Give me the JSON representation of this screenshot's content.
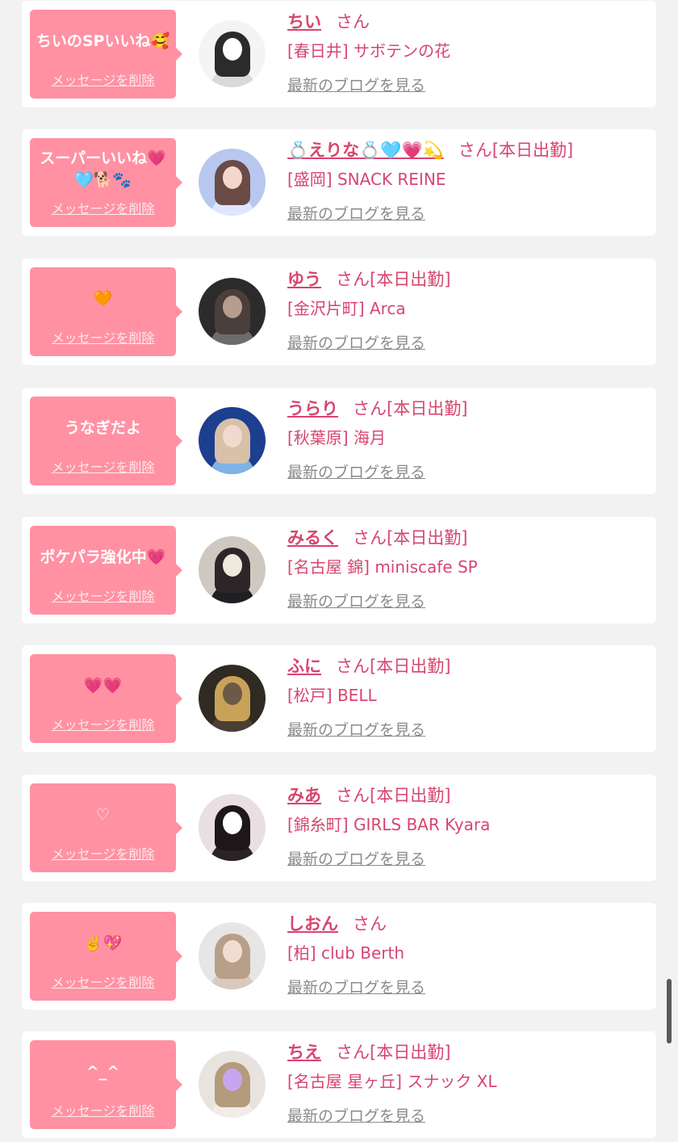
{
  "items": [
    {
      "message": "ちいのSPいいね🥰",
      "delete_label": "メッセージを削除",
      "name": "ちい",
      "honorific": "さん",
      "status": "",
      "shop": "[春日井] サボテンの花",
      "blog_label": "最新のブログを見る",
      "avatar_colors": {
        "bg": "#f4f4f4",
        "hair": "#2b2b2b",
        "face": "#ffffff",
        "body": "#d9d9d9"
      }
    },
    {
      "message": "スーパーいいね💗🩵🐕🐾",
      "delete_label": "メッセージを削除",
      "name": "💍えりな💍🩵💗💫",
      "honorific": "さん",
      "status": "[本日出勤]",
      "shop": "[盛岡] SNACK REINE",
      "blog_label": "最新のブログを見る",
      "avatar_colors": {
        "bg": "#b7c7ee",
        "hair": "#6a4b45",
        "face": "#f3d7cb",
        "body": "#dfe6ff"
      }
    },
    {
      "message": "🧡",
      "delete_label": "メッセージを削除",
      "name": "ゆう",
      "honorific": "さん",
      "status": "[本日出勤]",
      "shop": "[金沢片町] Arca",
      "blog_label": "最新のブログを見る",
      "avatar_colors": {
        "bg": "#2d2a2c",
        "hair": "#4a3f3a",
        "face": "#b79d8c",
        "body": "#6d6b6e"
      }
    },
    {
      "message": "うなぎだよ",
      "delete_label": "メッセージを削除",
      "name": "うらり",
      "honorific": "さん",
      "status": "[本日出勤]",
      "shop": "[秋葉原] 海月",
      "blog_label": "最新のブログを見る",
      "avatar_colors": {
        "bg": "#1d3f8f",
        "hair": "#d7c1a8",
        "face": "#f2d9cf",
        "body": "#7fb3e6"
      }
    },
    {
      "message": "ポケパラ強化中💗",
      "delete_label": "メッセージを削除",
      "name": "みるく",
      "honorific": "さん",
      "status": "[本日出勤]",
      "shop": "[名古屋 錦] miniscafe SP",
      "blog_label": "最新のブログを見る",
      "avatar_colors": {
        "bg": "#cfc8c0",
        "hair": "#2c2628",
        "face": "#efe8dc",
        "body": "#1f1f24"
      }
    },
    {
      "message": "💗💗",
      "delete_label": "メッセージを削除",
      "name": "ふに",
      "honorific": "さん",
      "status": "[本日出勤]",
      "shop": "[松戸] BELL",
      "blog_label": "最新のブログを見る",
      "avatar_colors": {
        "bg": "#2f2a22",
        "hair": "#c9a25a",
        "face": "#6b5a48",
        "body": "#4a3f35"
      }
    },
    {
      "message": "♡",
      "delete_label": "メッセージを削除",
      "name": "みあ",
      "honorific": "さん",
      "status": "[本日出勤]",
      "shop": "[錦糸町] GIRLS BAR Kyara",
      "blog_label": "最新のブログを見る",
      "avatar_colors": {
        "bg": "#e9dfe0",
        "hair": "#1d1719",
        "face": "#ffffff",
        "body": "#2a2224"
      }
    },
    {
      "message": "✌️💖",
      "delete_label": "メッセージを削除",
      "name": "しおん",
      "honorific": "さん",
      "status": "",
      "shop": "[柏] club Berth",
      "blog_label": "最新のブログを見る",
      "avatar_colors": {
        "bg": "#e7e5e6",
        "hair": "#b79f89",
        "face": "#f1dcd2",
        "body": "#d9c9bf"
      }
    },
    {
      "message": "^_^",
      "delete_label": "メッセージを削除",
      "name": "ちえ",
      "honorific": "さん",
      "status": "[本日出勤]",
      "shop": "[名古屋 星ヶ丘] スナック XL",
      "blog_label": "最新のブログを見る",
      "avatar_colors": {
        "bg": "#e8e3df",
        "hair": "#b49b7b",
        "face": "#c7a6f0",
        "body": "#f2ede8"
      }
    }
  ]
}
